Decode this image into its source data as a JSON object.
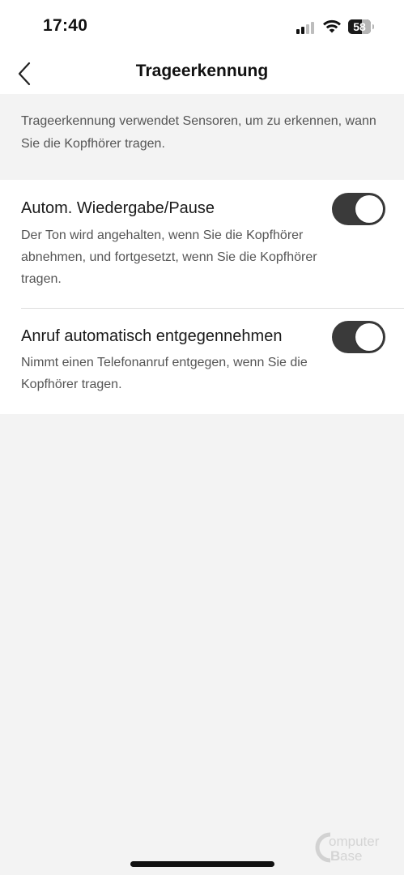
{
  "status_bar": {
    "time": "17:40",
    "battery_level": "58",
    "signal_bars_active": 2,
    "signal_bars_total": 4,
    "icons": [
      "signal-icon",
      "wifi-icon",
      "battery-icon"
    ]
  },
  "nav": {
    "title": "Trageerkennung",
    "back_icon": "chevron-left-icon"
  },
  "info": {
    "text": "Trageerkennung verwendet Sensoren, um zu erkennen, wann Sie die Kopfhörer tragen."
  },
  "settings": [
    {
      "title": "Autom. Wiedergabe/Pause",
      "description": "Der Ton wird angehalten, wenn Sie die Kopfhörer abnehmen, und fortgesetzt, wenn Sie die Kopfhörer tragen.",
      "enabled": true
    },
    {
      "title": "Anruf automatisch entgegennehmen",
      "description": "Nimmt einen Telefonanruf entgegen, wenn Sie die Kopfhörer tragen.",
      "enabled": true
    }
  ],
  "colors": {
    "toggle_on": "#3a3a3a",
    "background": "#f3f3f3",
    "card": "#ffffff",
    "secondary_text": "#555555"
  }
}
